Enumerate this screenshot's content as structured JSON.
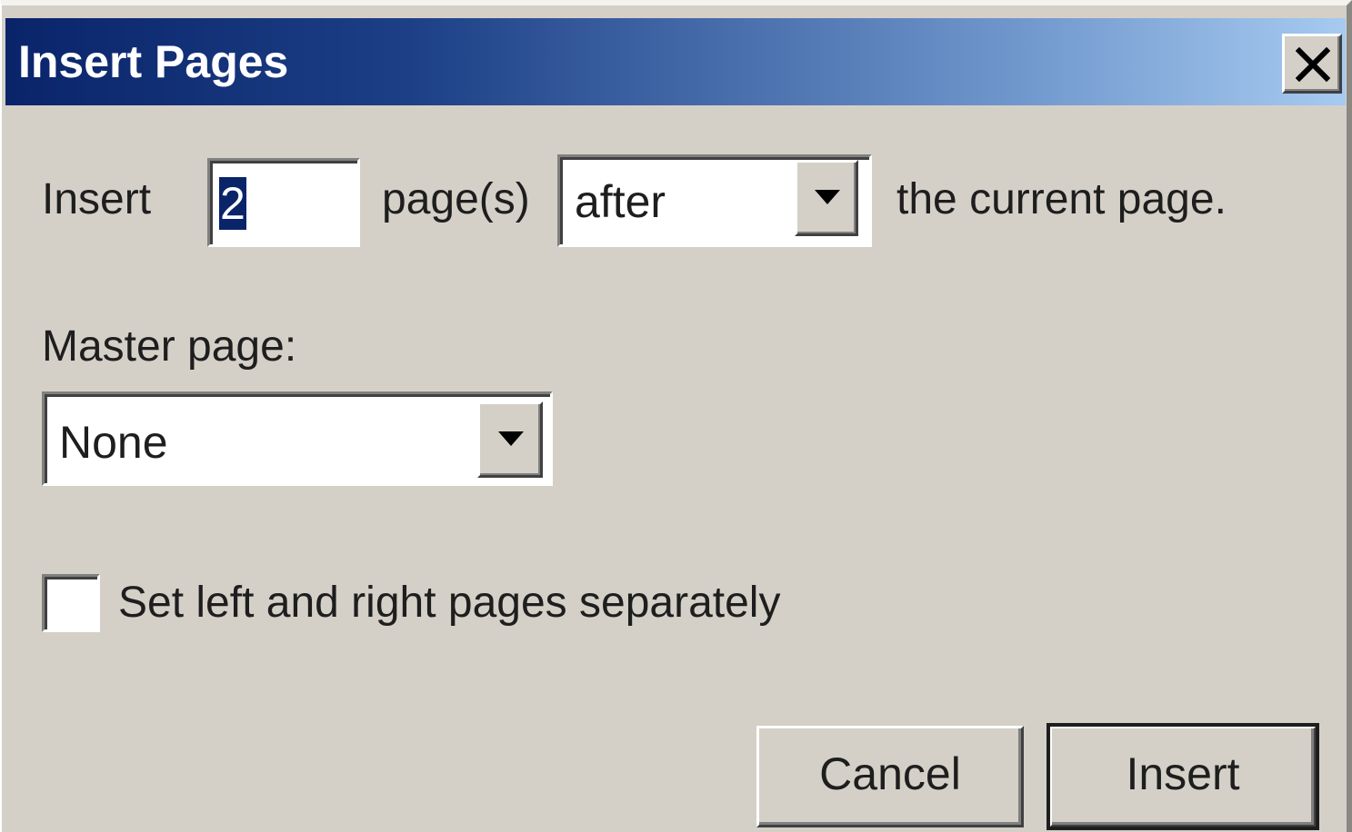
{
  "dialog": {
    "title": "Insert Pages",
    "close_icon": "close-icon"
  },
  "insert_row": {
    "prefix_label": "Insert",
    "page_count_value": "2",
    "pages_label": "page(s)",
    "position_selected": "after",
    "suffix_label": "the current page."
  },
  "master_page": {
    "label": "Master page:",
    "selected": "None"
  },
  "options": {
    "separate_pages_label": "Set left and right pages separately",
    "separate_pages_checked": false
  },
  "buttons": {
    "cancel_label": "Cancel",
    "insert_label": "Insert"
  },
  "icons": {
    "dropdown": "chevron-down-icon",
    "close": "close-icon"
  },
  "colors": {
    "titlebar_start": "#0a246a",
    "titlebar_end": "#a6caf0",
    "face": "#d4d0c8",
    "selection": "#0a246a"
  }
}
